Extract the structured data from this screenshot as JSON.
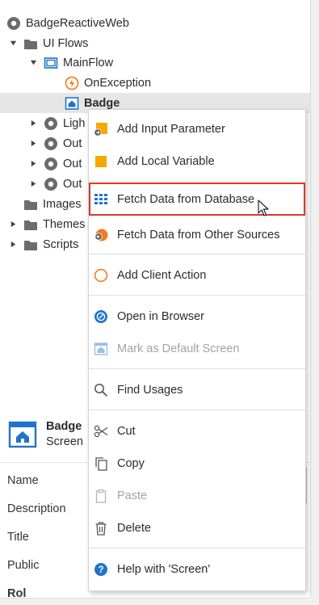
{
  "tree": {
    "items": [
      {
        "label": "BadgeReactiveWeb"
      },
      {
        "label": "UI Flows"
      },
      {
        "label": "MainFlow"
      },
      {
        "label": "OnException"
      },
      {
        "label": "Badge"
      },
      {
        "label": "Ligh"
      },
      {
        "label": "Out"
      },
      {
        "label": "Out"
      },
      {
        "label": "Out"
      },
      {
        "label": "Images"
      },
      {
        "label": "Themes"
      },
      {
        "label": "Scripts"
      }
    ]
  },
  "properties": {
    "element_name": "Badge",
    "element_type": "Screen",
    "rows": [
      "Name",
      "Description",
      "Title",
      "Public",
      "Rol"
    ]
  },
  "context_menu": {
    "items": [
      {
        "label": "Add Input Parameter",
        "icon": "input-parameter-icon"
      },
      {
        "label": "Add Local Variable",
        "icon": "local-variable-icon"
      },
      {
        "label": "Fetch Data from Database",
        "icon": "aggregate-icon"
      },
      {
        "label": "Fetch Data from Other Sources",
        "icon": "data-action-icon"
      },
      {
        "label": "Add Client Action",
        "icon": "client-action-icon"
      },
      {
        "label": "Open in Browser",
        "icon": "browser-icon"
      },
      {
        "label": "Mark as Default Screen",
        "icon": "home-screen-icon"
      },
      {
        "label": "Find Usages",
        "icon": "search-icon"
      },
      {
        "label": "Cut",
        "icon": "scissors-icon"
      },
      {
        "label": "Copy",
        "icon": "copy-icon"
      },
      {
        "label": "Paste",
        "icon": "clipboard-icon"
      },
      {
        "label": "Delete",
        "icon": "trash-icon"
      },
      {
        "label": "Help with 'Screen'",
        "icon": "help-icon"
      }
    ]
  },
  "colors": {
    "accent_blue": "#1f74c8",
    "highlight_border": "#d23c2a",
    "parameter_yellow": "#f5a800",
    "exception_orange": "#f07c1f"
  }
}
